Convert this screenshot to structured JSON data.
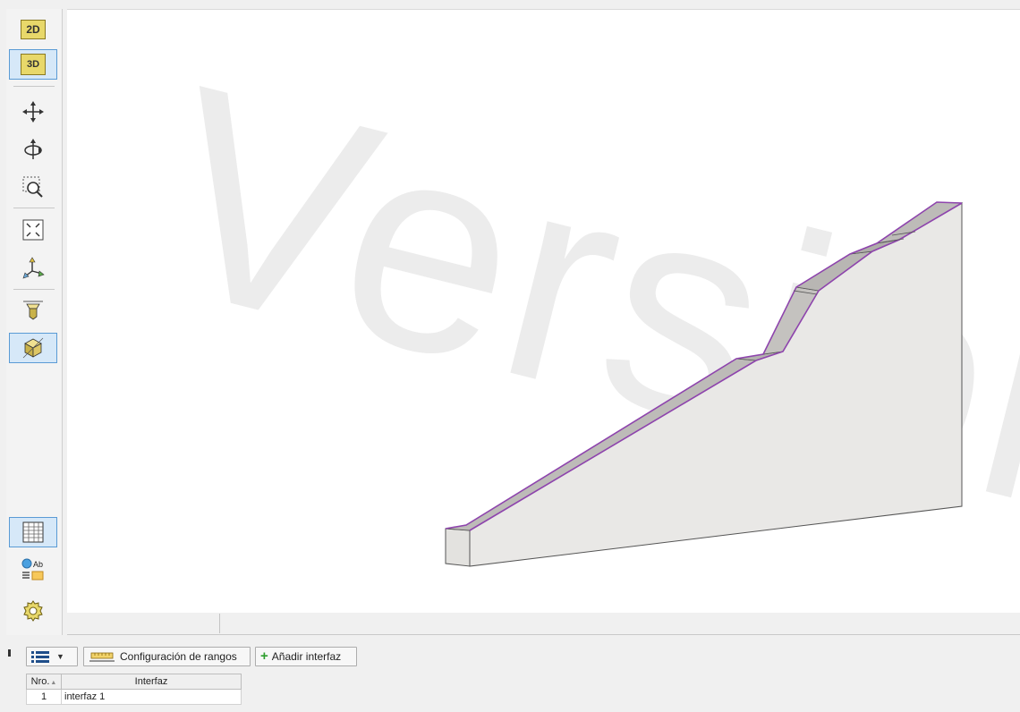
{
  "toolbar": {
    "btn_2d": "2D",
    "btn_3d": "3D",
    "items": [
      "move-icon",
      "rotate-icon",
      "zoom-window-icon",
      "fit-view-icon",
      "axes-icon",
      "view-from-top-icon",
      "isometric-view-icon",
      "table-icon",
      "legend-icon",
      "settings-icon"
    ]
  },
  "viewport": {
    "watermark": "Version"
  },
  "bottom_panel": {
    "range_config_label": "Configuración de rangos",
    "add_interface_label": "Añadir interfaz",
    "table": {
      "headers": [
        "Nro.",
        "Interfaz"
      ],
      "rows": [
        [
          "1",
          "interfaz 1"
        ]
      ]
    }
  },
  "colors": {
    "accent": "#5a9bd5",
    "interface_line": "#8e44ad",
    "add_icon": "#2e9e2e",
    "model_face": "#e9e8e6"
  }
}
